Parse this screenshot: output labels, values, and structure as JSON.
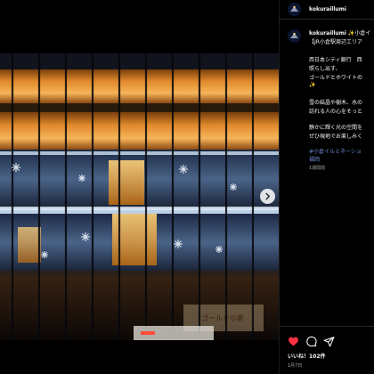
{
  "post": {
    "username": "kokuraillumi",
    "caption_user": "kokuraillumi",
    "caption_head": "✨小倉イ",
    "caption_title": "【JR小倉駅周辺エリア",
    "caption_lines": [
      "西日本シティ銀行　西",
      "照らし出す、",
      "ゴールドとホワイトの",
      "✨",
      "雪の結晶や樹木、水の",
      "訪れる人の心をそっと",
      "静かに輝く光の空間を",
      "ぜひ現地でお楽しみく"
    ],
    "hashtags": [
      "#小倉イルミネーショ",
      "福岡"
    ],
    "time_ago": "1週間前",
    "likes": "いいね！102件",
    "date": "1月7日"
  },
  "photo": {
    "storefront_sign": "ゴールド小倉"
  },
  "icons": {
    "like": "heart-icon",
    "comment": "comment-icon",
    "share": "share-icon",
    "next": "chevron-right-icon"
  },
  "colors": {
    "heart": "#ff3040",
    "hashtag": "#6d8fd8",
    "warm_light": "#f2a13d",
    "cool_light": "#cfe3f5"
  }
}
